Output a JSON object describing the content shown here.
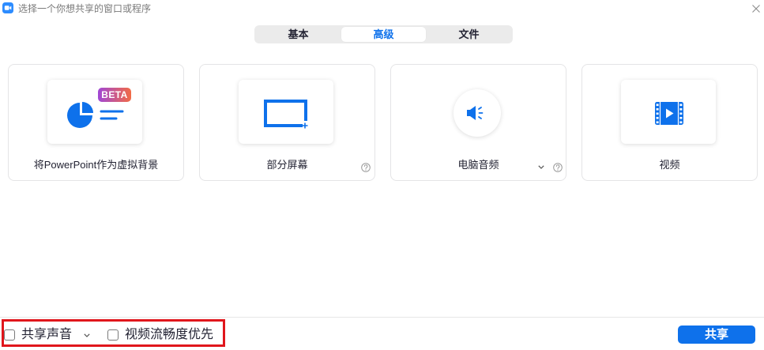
{
  "window": {
    "title": "选择一个你想共享的窗口或程序",
    "app_icon": "zoom-video-icon",
    "close_icon": "close-icon"
  },
  "tabs": [
    {
      "label": "基本",
      "selected": false
    },
    {
      "label": "高级",
      "selected": true
    },
    {
      "label": "文件",
      "selected": false
    }
  ],
  "cards": [
    {
      "label": "将PowerPoint作为虚拟背景",
      "icon": "pie-chart-icon",
      "badge": "BETA"
    },
    {
      "label": "部分屏幕",
      "icon": "screen-portion-icon",
      "help_icon": "question-circle-icon"
    },
    {
      "label": "电脑音频",
      "icon": "speaker-icon",
      "dropdown_icon": "chevron-down-icon",
      "help_icon": "question-circle-icon"
    },
    {
      "label": "视频",
      "icon": "video-film-icon"
    }
  ],
  "footer": {
    "share_sound": {
      "label": "共享声音",
      "checked": false,
      "dropdown_icon": "chevron-down-icon"
    },
    "optimize_video": {
      "label": "视频流畅度优先",
      "checked": false
    },
    "share_button": "共享"
  },
  "colors": {
    "accent": "#0e71eb",
    "tab_track": "#ebebeb",
    "badge_gradient_start": "#a047d6",
    "badge_gradient_end": "#f26b45",
    "highlight_border": "#e0161c"
  }
}
